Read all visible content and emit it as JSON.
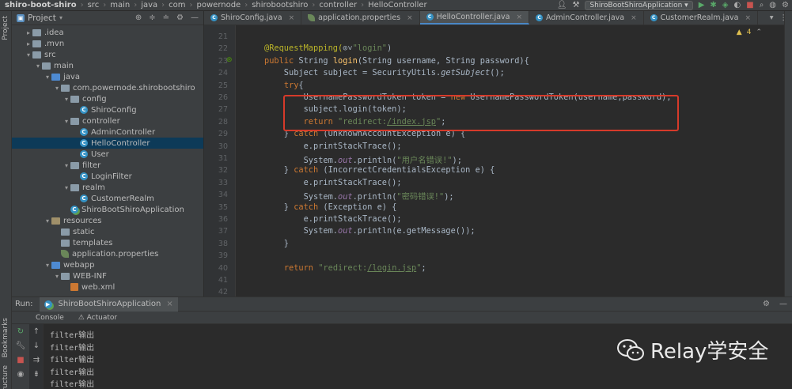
{
  "breadcrumb": [
    "shiro-boot-shiro",
    "src",
    "main",
    "java",
    "com",
    "powernode",
    "shirobootshiro",
    "controller",
    "HelloController"
  ],
  "toolbar": {
    "run_config": "ShiroBootShiroApplication"
  },
  "left_stripe": {
    "project": "Project",
    "bookmarks": "Bookmarks",
    "structure": "Structure"
  },
  "project_panel": {
    "title": "Project",
    "tree": [
      {
        "label": ".idea",
        "depth": 1,
        "arrow": "▸",
        "icon": "folder"
      },
      {
        "label": ".mvn",
        "depth": 1,
        "arrow": "▸",
        "icon": "folder"
      },
      {
        "label": "src",
        "depth": 1,
        "arrow": "▾",
        "icon": "folder"
      },
      {
        "label": "main",
        "depth": 2,
        "arrow": "▾",
        "icon": "folder"
      },
      {
        "label": "java",
        "depth": 3,
        "arrow": "▾",
        "icon": "folder-blue"
      },
      {
        "label": "com.powernode.shirobootshiro",
        "depth": 4,
        "arrow": "▾",
        "icon": "pkg"
      },
      {
        "label": "config",
        "depth": 5,
        "arrow": "▾",
        "icon": "pkg"
      },
      {
        "label": "ShiroConfig",
        "depth": 6,
        "arrow": "",
        "icon": "class"
      },
      {
        "label": "controller",
        "depth": 5,
        "arrow": "▾",
        "icon": "pkg"
      },
      {
        "label": "AdminController",
        "depth": 6,
        "arrow": "",
        "icon": "class"
      },
      {
        "label": "HelloController",
        "depth": 6,
        "arrow": "",
        "icon": "class",
        "selected": true
      },
      {
        "label": "User",
        "depth": 6,
        "arrow": "",
        "icon": "class"
      },
      {
        "label": "filter",
        "depth": 5,
        "arrow": "▾",
        "icon": "pkg"
      },
      {
        "label": "LoginFilter",
        "depth": 6,
        "arrow": "",
        "icon": "class"
      },
      {
        "label": "realm",
        "depth": 5,
        "arrow": "▾",
        "icon": "pkg"
      },
      {
        "label": "CustomerRealm",
        "depth": 6,
        "arrow": "",
        "icon": "class"
      },
      {
        "label": "ShiroBootShiroApplication",
        "depth": 5,
        "arrow": "",
        "icon": "app"
      },
      {
        "label": "resources",
        "depth": 3,
        "arrow": "▾",
        "icon": "res"
      },
      {
        "label": "static",
        "depth": 4,
        "arrow": "",
        "icon": "folder"
      },
      {
        "label": "templates",
        "depth": 4,
        "arrow": "",
        "icon": "folder"
      },
      {
        "label": "application.properties",
        "depth": 4,
        "arrow": "",
        "icon": "leaf"
      },
      {
        "label": "webapp",
        "depth": 3,
        "arrow": "▾",
        "icon": "folder-blue"
      },
      {
        "label": "WEB-INF",
        "depth": 4,
        "arrow": "▾",
        "icon": "folder"
      },
      {
        "label": "web.xml",
        "depth": 5,
        "arrow": "",
        "icon": "xml"
      }
    ]
  },
  "tabs": [
    {
      "label": "ShiroConfig.java",
      "icon": "class",
      "active": false
    },
    {
      "label": "application.properties",
      "icon": "leaf",
      "active": false
    },
    {
      "label": "HelloController.java",
      "icon": "class",
      "active": true
    },
    {
      "label": "AdminController.java",
      "icon": "class",
      "active": false
    },
    {
      "label": "CustomerRealm.java",
      "icon": "class",
      "active": false
    }
  ],
  "editor": {
    "warnings": "4",
    "lines": [
      {
        "n": "21",
        "segs": []
      },
      {
        "n": "22",
        "segs": [
          {
            "t": "@RequestMapping(",
            "c": "ann"
          },
          {
            "t": "⊙˅",
            "c": ""
          },
          {
            "t": "\"login\"",
            "c": "str"
          },
          {
            "t": ")",
            "c": ""
          }
        ]
      },
      {
        "n": "23",
        "mark": true,
        "segs": [
          {
            "t": "public ",
            "c": "kw"
          },
          {
            "t": "String ",
            "c": ""
          },
          {
            "t": "login",
            "c": "fn"
          },
          {
            "t": "(String username, String password){",
            "c": ""
          }
        ]
      },
      {
        "n": "24",
        "segs": [
          {
            "t": "    Subject subject = SecurityUtils.",
            "c": ""
          },
          {
            "t": "getSubject",
            "c": "itl"
          },
          {
            "t": "();",
            "c": ""
          }
        ]
      },
      {
        "n": "25",
        "segs": [
          {
            "t": "    ",
            "c": ""
          },
          {
            "t": "try",
            "c": "kw"
          },
          {
            "t": "{",
            "c": ""
          }
        ]
      },
      {
        "n": "26",
        "segs": [
          {
            "t": "        UsernamePasswordToken token = ",
            "c": ""
          },
          {
            "t": "new ",
            "c": "kw"
          },
          {
            "t": "UsernamePasswordToken(username,password);",
            "c": ""
          }
        ]
      },
      {
        "n": "27",
        "segs": [
          {
            "t": "        subject.login(token);",
            "c": ""
          }
        ]
      },
      {
        "n": "28",
        "segs": [
          {
            "t": "        ",
            "c": ""
          },
          {
            "t": "return ",
            "c": "kw"
          },
          {
            "t": "\"redirect:",
            "c": "str"
          },
          {
            "t": "/index.jsp",
            "c": "str ul"
          },
          {
            "t": "\"",
            "c": "str"
          },
          {
            "t": ";",
            "c": ""
          }
        ]
      },
      {
        "n": "29",
        "segs": [
          {
            "t": "    } ",
            "c": ""
          },
          {
            "t": "catch ",
            "c": "kw"
          },
          {
            "t": "(UnknownAccountException e) {",
            "c": ""
          }
        ]
      },
      {
        "n": "30",
        "segs": [
          {
            "t": "        e.printStackTrace();",
            "c": ""
          }
        ]
      },
      {
        "n": "31",
        "segs": [
          {
            "t": "        System.",
            "c": ""
          },
          {
            "t": "out",
            "c": "fld"
          },
          {
            "t": ".println(",
            "c": ""
          },
          {
            "t": "\"用户名错误!\"",
            "c": "str"
          },
          {
            "t": ");",
            "c": ""
          }
        ]
      },
      {
        "n": "32",
        "segs": [
          {
            "t": "    } ",
            "c": ""
          },
          {
            "t": "catch ",
            "c": "kw"
          },
          {
            "t": "(IncorrectCredentialsException e) {",
            "c": ""
          }
        ]
      },
      {
        "n": "33",
        "segs": [
          {
            "t": "        e.printStackTrace();",
            "c": ""
          }
        ]
      },
      {
        "n": "34",
        "segs": [
          {
            "t": "        System.",
            "c": ""
          },
          {
            "t": "out",
            "c": "fld"
          },
          {
            "t": ".println(",
            "c": ""
          },
          {
            "t": "\"密码错误!\"",
            "c": "str"
          },
          {
            "t": ");",
            "c": ""
          }
        ]
      },
      {
        "n": "35",
        "segs": [
          {
            "t": "    } ",
            "c": ""
          },
          {
            "t": "catch ",
            "c": "kw"
          },
          {
            "t": "(Exception e) {",
            "c": ""
          }
        ]
      },
      {
        "n": "36",
        "segs": [
          {
            "t": "        e.printStackTrace();",
            "c": ""
          }
        ]
      },
      {
        "n": "37",
        "segs": [
          {
            "t": "        System.",
            "c": ""
          },
          {
            "t": "out",
            "c": "fld"
          },
          {
            "t": ".println(e.getMessage());",
            "c": ""
          }
        ]
      },
      {
        "n": "38",
        "segs": [
          {
            "t": "    }",
            "c": ""
          }
        ]
      },
      {
        "n": "39",
        "segs": []
      },
      {
        "n": "40",
        "segs": [
          {
            "t": "    ",
            "c": ""
          },
          {
            "t": "return ",
            "c": "kw"
          },
          {
            "t": "\"redirect:",
            "c": "str"
          },
          {
            "t": "/login.jsp",
            "c": "str ul"
          },
          {
            "t": "\"",
            "c": "str"
          },
          {
            "t": ";",
            "c": ""
          }
        ]
      },
      {
        "n": "41",
        "segs": []
      },
      {
        "n": "42",
        "segs": []
      }
    ]
  },
  "run_panel": {
    "label": "Run:",
    "config_tab": "ShiroBootShiroApplication",
    "subtabs": [
      "Console",
      "Actuator"
    ],
    "console_lines": [
      "filter输出",
      "filter输出",
      "filter输出",
      "filter输出",
      "filter输出"
    ]
  },
  "watermark": {
    "text": "Relay学安全"
  },
  "colors": {
    "accent": "#4a88c7",
    "highlight_box": "#d63a2a",
    "keyword": "#cc7832",
    "string": "#6a8759"
  }
}
